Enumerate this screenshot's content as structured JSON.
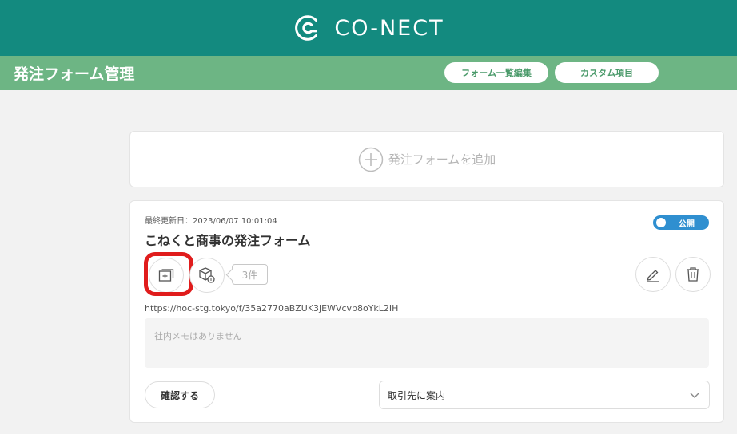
{
  "header": {
    "logo_text": "CO-NECT",
    "logo_icon": "conect-logo-icon",
    "color": "#138a7f"
  },
  "subheader": {
    "title": "発注フォーム管理",
    "buttons": [
      "フォーム一覧編集",
      "カスタム項目"
    ],
    "color": "#6db584"
  },
  "add_form": {
    "label": "発注フォームを追加",
    "icon": "plus-circle-icon"
  },
  "form_card": {
    "updated": "最終更新日：2023/06/07 10:01:04",
    "title": "こねくと商事の発注フォーム",
    "toggle_label": "公開",
    "toggle_on": true,
    "toggle_color": "#2f8fd0",
    "count_label": "3件",
    "url": "https://hoc-stg.tokyo/f/35a2770aBZUK3jEWVcvp8oYkL2IH",
    "memo_placeholder": "社内メモはありません",
    "confirm_label": "確認する",
    "select_value": "取引先に案内",
    "highlight_color": "#e01c1c"
  }
}
